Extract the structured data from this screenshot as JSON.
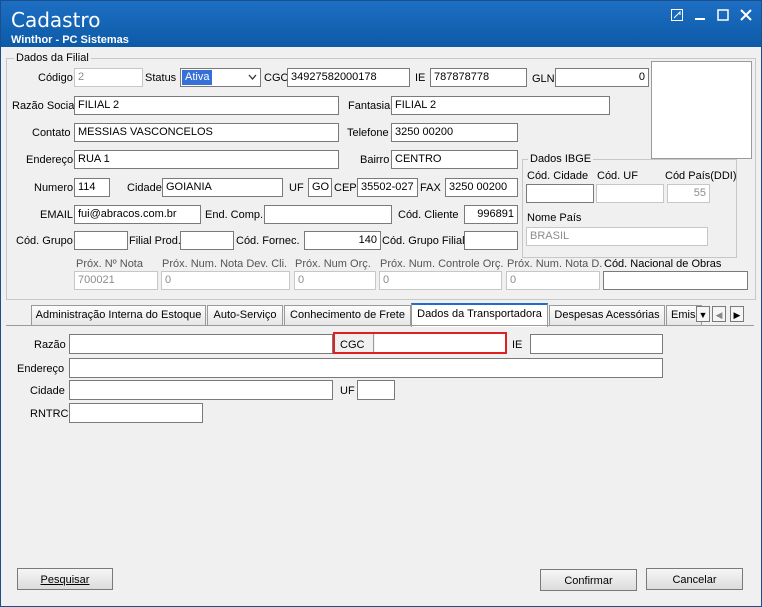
{
  "window": {
    "title": "Cadastro",
    "subtitle": "Winthor - PC Sistemas"
  },
  "filial_group": {
    "title": "Dados da Filial"
  },
  "fields": {
    "codigo": {
      "label": "Código",
      "value": "2"
    },
    "status": {
      "label": "Status",
      "value": "Ativa"
    },
    "cgc": {
      "label": "CGC",
      "value": "34927582000178"
    },
    "ie": {
      "label": "IE",
      "value": "787878778"
    },
    "gln": {
      "label": "GLN",
      "value": "0"
    },
    "razao_social": {
      "label": "Razão Social",
      "value": "FILIAL 2"
    },
    "fantasia": {
      "label": "Fantasia",
      "value": "FILIAL 2"
    },
    "contato": {
      "label": "Contato",
      "value": "MESSIAS VASCONCELOS"
    },
    "telefone": {
      "label": "Telefone",
      "value": "3250 00200"
    },
    "endereco": {
      "label": "Endereço",
      "value": "RUA 1"
    },
    "bairro": {
      "label": "Bairro",
      "value": "CENTRO"
    },
    "numero": {
      "label": "Numero",
      "value": "114"
    },
    "cidade": {
      "label": "Cidade",
      "value": "GOIANIA"
    },
    "uf": {
      "label": "UF",
      "value": "GO"
    },
    "cep": {
      "label": "CEP",
      "value": "35502-027"
    },
    "fax": {
      "label": "FAX",
      "value": "3250 00200"
    },
    "email": {
      "label": "EMAIL",
      "value": "fui@abracos.com.br"
    },
    "end_comp": {
      "label": "End. Comp.",
      "value": ""
    },
    "cod_cliente": {
      "label": "Cód. Cliente",
      "value": "996891"
    },
    "cod_grupo": {
      "label": "Cód. Grupo",
      "value": ""
    },
    "filial_prod": {
      "label": "Filial Prod.",
      "value": ""
    },
    "cod_fornec": {
      "label": "Cód. Fornec.",
      "value": "140"
    },
    "cod_grupo_filial": {
      "label": "Cód. Grupo Filial",
      "value": ""
    }
  },
  "ibge": {
    "title": "Dados IBGE",
    "cod_cidade": {
      "label": "Cód. Cidade",
      "value": ""
    },
    "cod_uf": {
      "label": "Cód. UF",
      "value": ""
    },
    "cod_pais": {
      "label": "Cód País(DDI)",
      "value": "55"
    },
    "nome_pais": {
      "label": "Nome País",
      "value": "BRASIL"
    }
  },
  "prox": {
    "nota": {
      "label": "Próx. Nº Nota",
      "value": "700021"
    },
    "nota_dev": {
      "label": "Próx. Num. Nota Dev. Cli.",
      "value": "0"
    },
    "orc": {
      "label": "Próx. Num Orç.",
      "value": "0"
    },
    "controle_orc": {
      "label": "Próx. Num. Controle Orç.",
      "value": "0"
    },
    "nota_d": {
      "label": "Próx. Num. Nota D.",
      "value": "0"
    },
    "cod_obras": {
      "label": "Cód. Nacional de Obras",
      "value": ""
    }
  },
  "tabs": [
    {
      "label": "Administração Interna do Estoque"
    },
    {
      "label": "Auto-Serviço"
    },
    {
      "label": "Conhecimento de Frete"
    },
    {
      "label": "Dados da Transportadora"
    },
    {
      "label": "Despesas Acessórias"
    },
    {
      "label": "Emiss"
    }
  ],
  "transportadora": {
    "razao": {
      "label": "Razão",
      "value": ""
    },
    "cgc": {
      "label": "CGC",
      "value": ""
    },
    "ie": {
      "label": "IE",
      "value": ""
    },
    "endereco": {
      "label": "Endereço",
      "value": ""
    },
    "cidade": {
      "label": "Cidade",
      "value": ""
    },
    "uf": {
      "label": "UF",
      "value": ""
    },
    "rntrc": {
      "label": "RNTRC",
      "value": ""
    }
  },
  "buttons": {
    "pesquisar": "Pesquisar",
    "confirmar": "Confirmar",
    "cancelar": "Cancelar"
  },
  "colors": {
    "titlebar": "#1565c0",
    "highlight": "#e02020",
    "select_bg": "#3470d8"
  }
}
